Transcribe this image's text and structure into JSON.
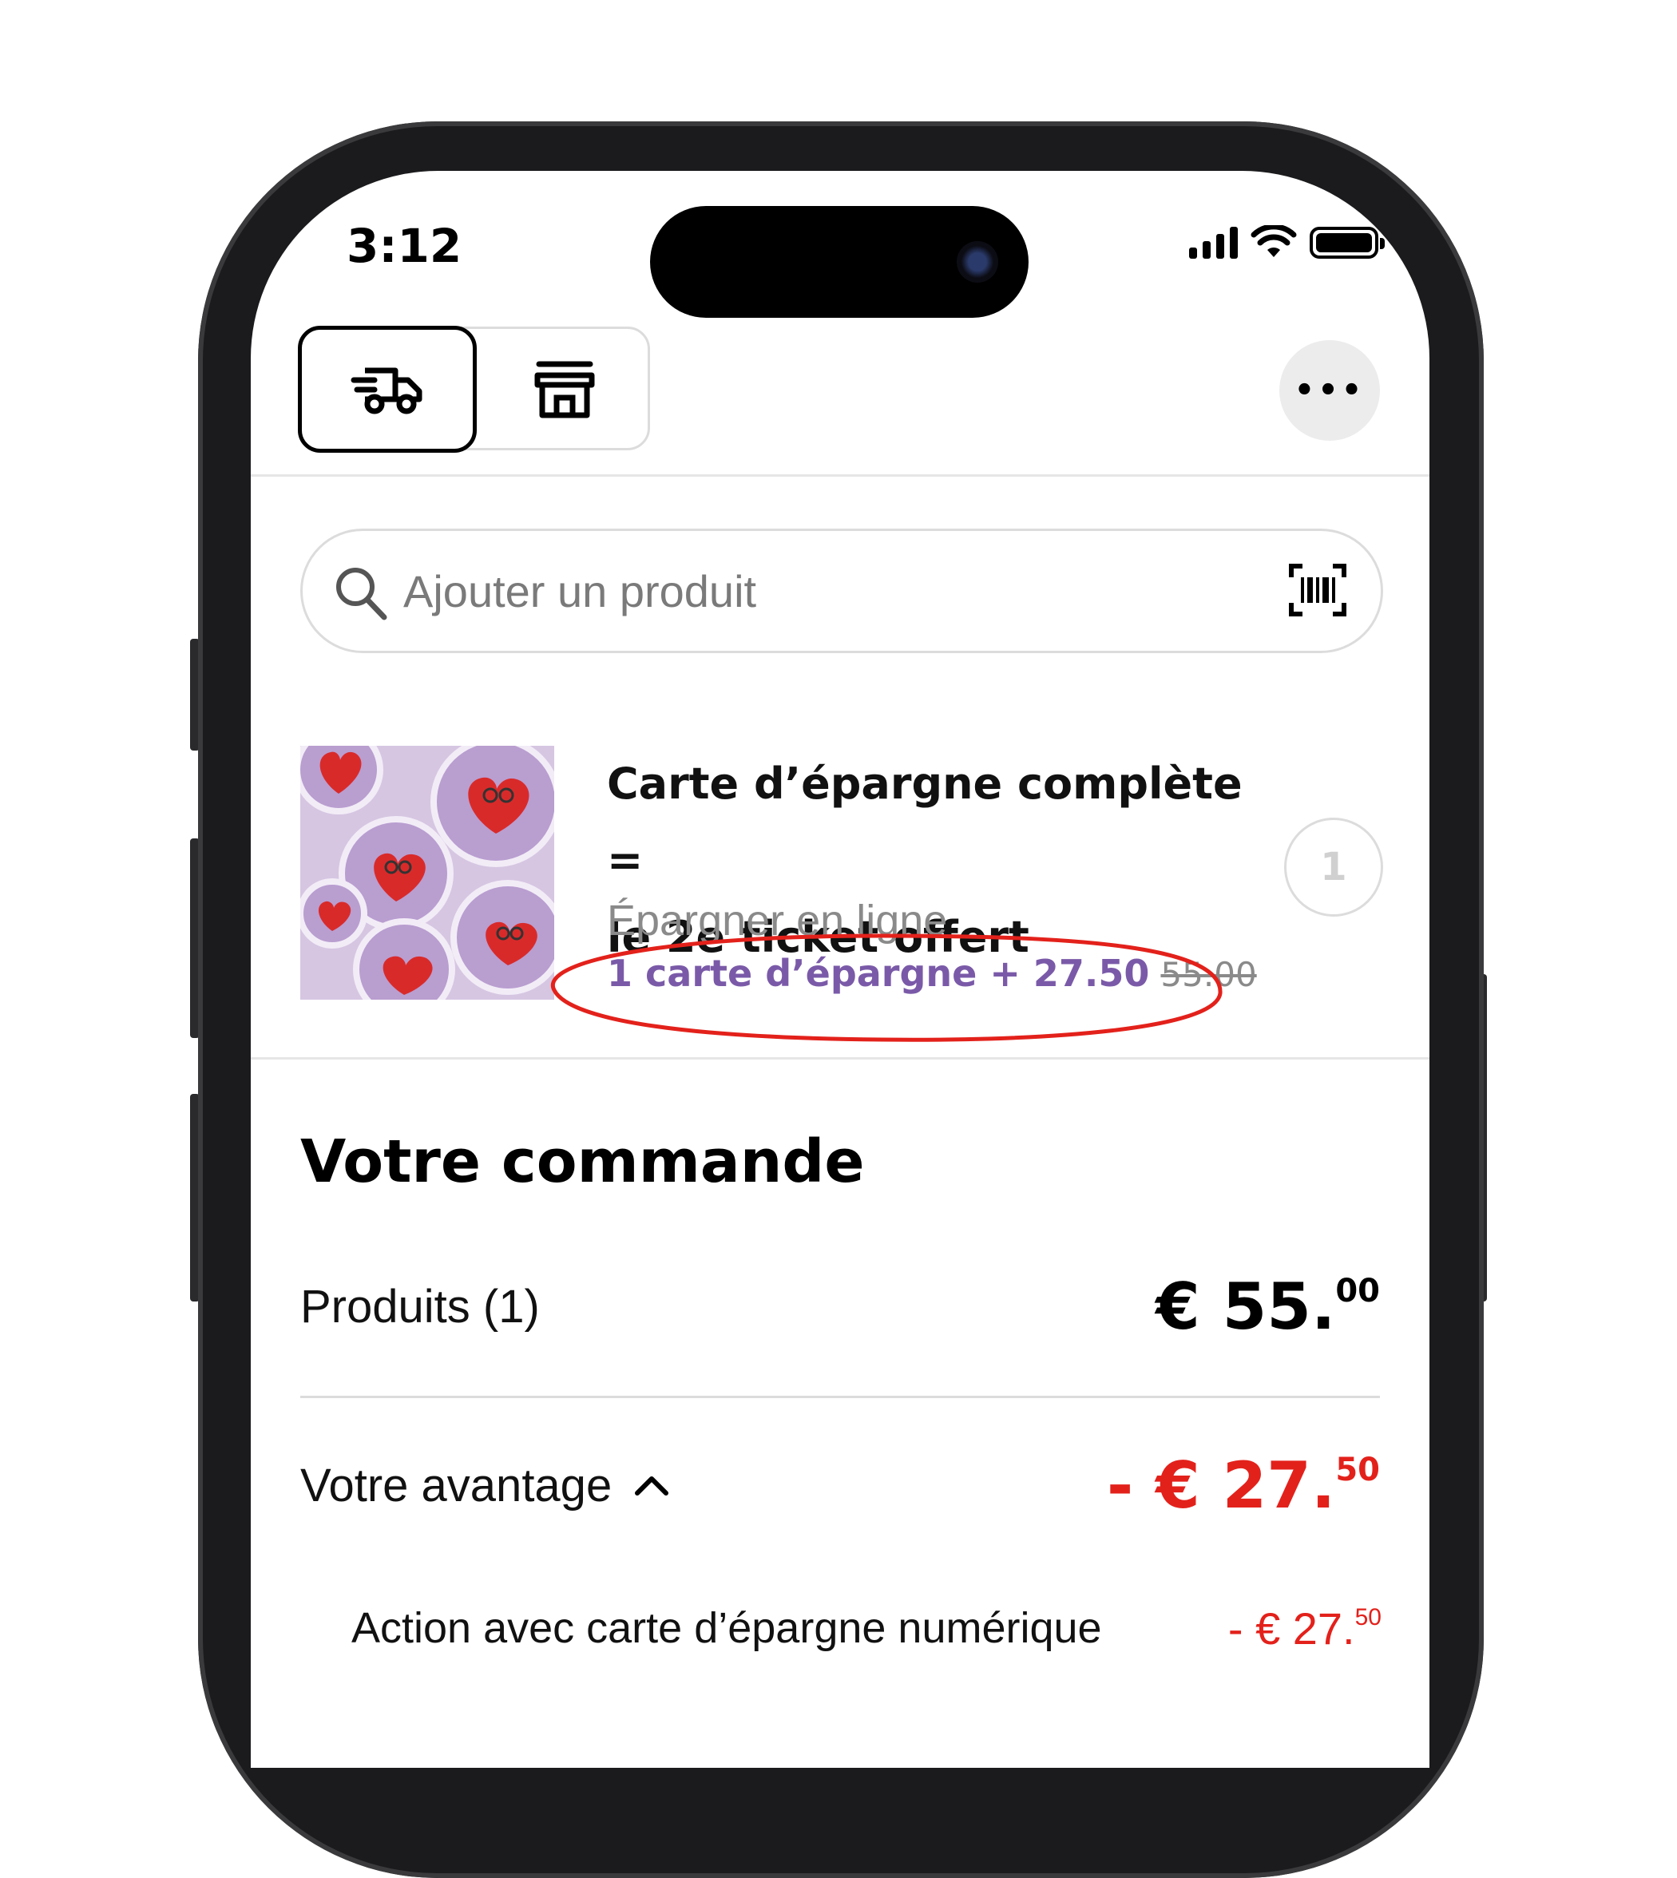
{
  "status_bar": {
    "time": "3:12"
  },
  "header": {
    "mode_delivery_icon": "delivery-truck-icon",
    "mode_store_icon": "store-icon",
    "more_icon": "more-horizontal-icon",
    "more_label": "•••"
  },
  "search": {
    "placeholder": "Ajouter un produit",
    "search_icon": "search-icon",
    "scan_icon": "barcode-scan-icon"
  },
  "product": {
    "title_line1": "Carte d’épargne complète =",
    "title_line2": "le 2e ticket offert",
    "subtitle": "Épargner en ligne",
    "price_text": "1 carte d’épargne + 27.50",
    "old_price": "55.00",
    "quantity": "1"
  },
  "order": {
    "title": "Votre commande",
    "products_label": "Produits (1)",
    "products_amount_main": "€ 55.",
    "products_amount_cents": "00",
    "advantage_label": "Votre avantage",
    "advantage_amount_main": "- € 27.",
    "advantage_amount_cents": "50",
    "action_label": "Action avec carte d’épargne numérique",
    "action_amount_main": "- € 27.",
    "action_amount_cents": "50"
  },
  "colors": {
    "accent_red": "#e3211b",
    "promo_purple": "#7a5aa8",
    "muted_gray": "#8a8a8a"
  }
}
